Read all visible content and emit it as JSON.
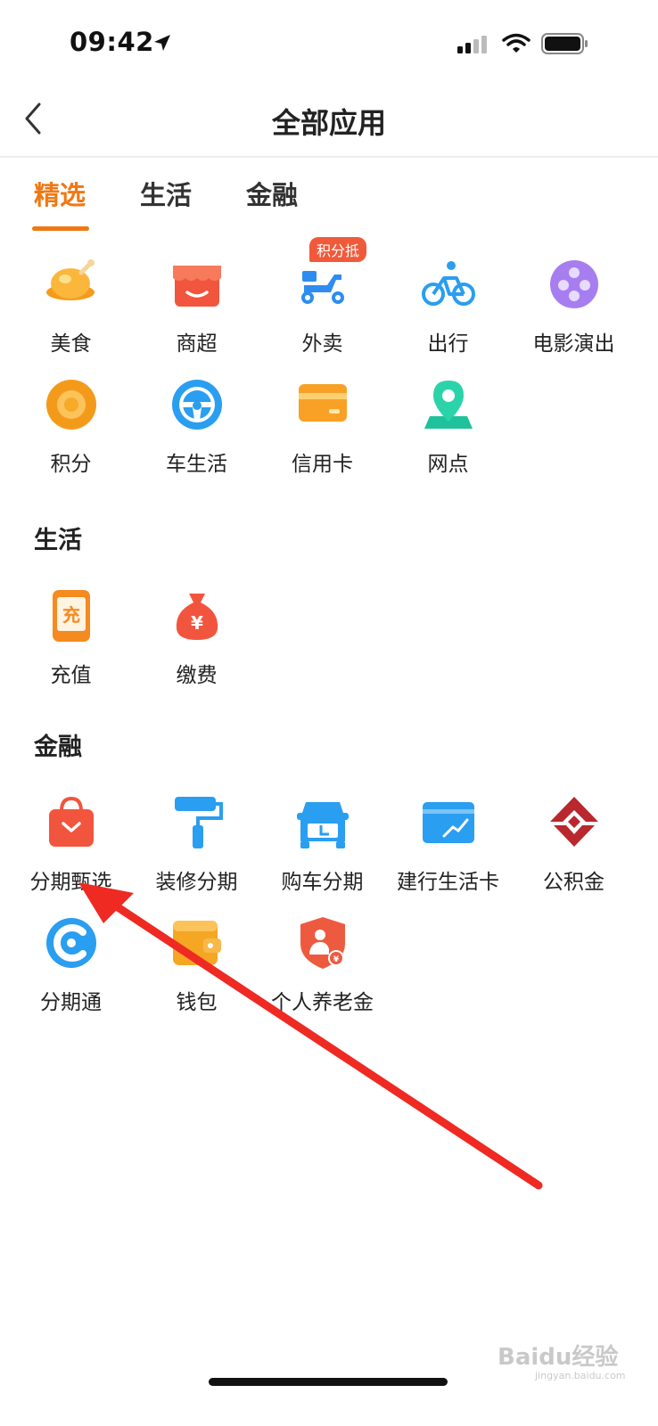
{
  "status": {
    "time": "09:42"
  },
  "nav": {
    "title": "全部应用"
  },
  "tabs": [
    {
      "label": "精选",
      "active": true
    },
    {
      "label": "生活",
      "active": false
    },
    {
      "label": "金融",
      "active": false
    }
  ],
  "featured": {
    "badge": "积分抵",
    "items": [
      {
        "label": "美食",
        "icon": "roast-chicken-icon"
      },
      {
        "label": "商超",
        "icon": "store-icon"
      },
      {
        "label": "外卖",
        "icon": "scooter-icon"
      },
      {
        "label": "出行",
        "icon": "bicycle-icon"
      },
      {
        "label": "电影演出",
        "icon": "film-reel-icon"
      },
      {
        "label": "积分",
        "icon": "points-coin-icon"
      },
      {
        "label": "车生活",
        "icon": "steering-wheel-icon"
      },
      {
        "label": "信用卡",
        "icon": "credit-card-icon"
      },
      {
        "label": "网点",
        "icon": "location-pin-icon"
      }
    ]
  },
  "life": {
    "title": "生活",
    "items": [
      {
        "label": "充值",
        "icon": "phone-recharge-icon",
        "glyph": "充"
      },
      {
        "label": "缴费",
        "icon": "money-bag-icon",
        "glyph": "¥"
      }
    ]
  },
  "finance": {
    "title": "金融",
    "items": [
      {
        "label": "分期甄选",
        "icon": "shopping-bag-icon"
      },
      {
        "label": "装修分期",
        "icon": "paint-roller-icon"
      },
      {
        "label": "购车分期",
        "icon": "car-icon"
      },
      {
        "label": "建行生活卡",
        "icon": "life-card-icon"
      },
      {
        "label": "公积金",
        "icon": "housing-fund-logo-icon"
      },
      {
        "label": "分期通",
        "icon": "installment-c-icon"
      },
      {
        "label": "钱包",
        "icon": "wallet-icon"
      },
      {
        "label": "个人养老金",
        "icon": "pension-shield-icon",
        "glyph": "¥"
      }
    ]
  },
  "watermark": {
    "text": "Baidu经验",
    "sub": "jingyan.baidu.com"
  },
  "colors": {
    "accent": "#f07814",
    "arrow": "#ee2a22"
  }
}
